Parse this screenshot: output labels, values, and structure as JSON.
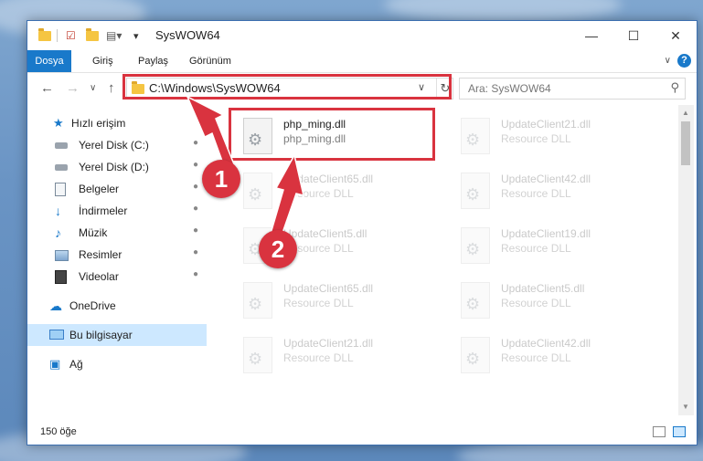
{
  "window": {
    "title": "SysWOW64"
  },
  "ribbon": {
    "tabs": [
      "Dosya",
      "Giriş",
      "Paylaş",
      "Görünüm"
    ]
  },
  "address": {
    "path": "C:\\Windows\\SysWOW64"
  },
  "search": {
    "placeholder": "Ara: SysWOW64"
  },
  "sidebar": {
    "items": [
      {
        "label": "Hızlı erişim",
        "icon": "star-icon"
      },
      {
        "label": "Yerel Disk (C:)",
        "icon": "drive-icon",
        "pinned": true
      },
      {
        "label": "Yerel Disk (D:)",
        "icon": "drive-icon",
        "pinned": true
      },
      {
        "label": "Belgeler",
        "icon": "document-icon",
        "pinned": true
      },
      {
        "label": "İndirmeler",
        "icon": "download-icon",
        "pinned": true
      },
      {
        "label": "Müzik",
        "icon": "music-icon",
        "pinned": true
      },
      {
        "label": "Resimler",
        "icon": "picture-icon",
        "pinned": true
      },
      {
        "label": "Videolar",
        "icon": "video-icon",
        "pinned": true
      },
      {
        "label": "OneDrive",
        "icon": "cloud-icon"
      },
      {
        "label": "Bu bilgisayar",
        "icon": "computer-icon",
        "selected": true
      },
      {
        "label": "Ağ",
        "icon": "network-icon"
      }
    ]
  },
  "files": [
    {
      "name": "php_ming.dll",
      "type": "php_ming.dll",
      "highlighted": true
    },
    {
      "name": "UpdateClient21.dll",
      "type": "Resource DLL"
    },
    {
      "name": "UpdateClient65.dll",
      "type": "Resource DLL"
    },
    {
      "name": "UpdateClient42.dll",
      "type": "Resource DLL"
    },
    {
      "name": "UpdateClient5.dll",
      "type": "Resource DLL"
    },
    {
      "name": "UpdateClient19.dll",
      "type": "Resource DLL"
    },
    {
      "name": "UpdateClient65.dll",
      "type": "Resource DLL"
    },
    {
      "name": "UpdateClient5.dll",
      "type": "Resource DLL"
    },
    {
      "name": "UpdateClient21.dll",
      "type": "Resource DLL"
    },
    {
      "name": "UpdateClient42.dll",
      "type": "Resource DLL"
    }
  ],
  "status": {
    "item_count": "150 öğe"
  },
  "annotations": {
    "step1": "1",
    "step2": "2"
  },
  "colors": {
    "accent": "#1979ca",
    "highlight": "#d9333f"
  }
}
